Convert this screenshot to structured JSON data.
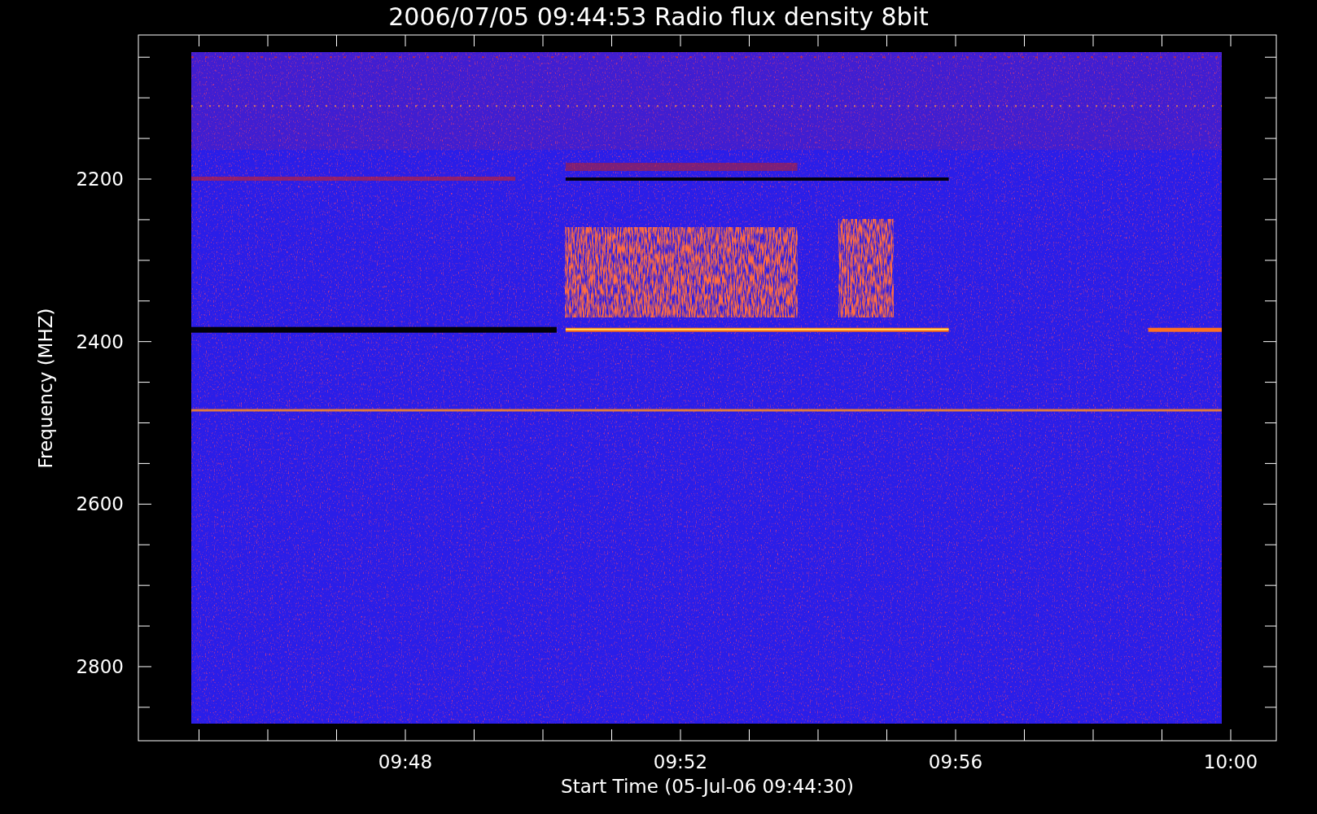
{
  "title": "2006/07/05 09:44:53 Radio flux density 8bit",
  "y_axis": {
    "label": "Frequency (MHZ)",
    "ticks": [
      "2200",
      "2400",
      "2600",
      "2800"
    ]
  },
  "x_axis": {
    "label": "Start Time (05-Jul-06 09:44:30)",
    "ticks": [
      "09:48",
      "09:52",
      "09:56",
      "10:00"
    ]
  }
}
